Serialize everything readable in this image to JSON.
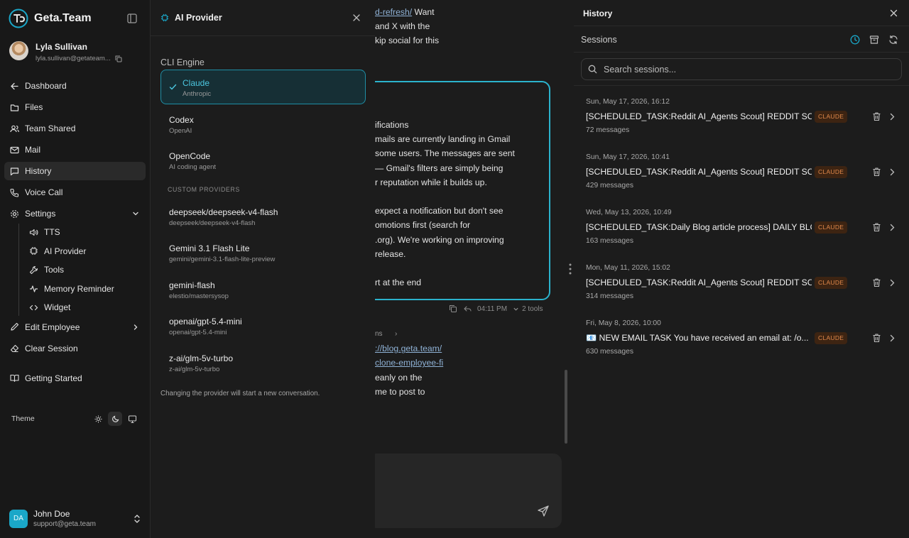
{
  "brand": {
    "name": "Geta.Team"
  },
  "user": {
    "name": "Lyla Sullivan",
    "email": "lyla.sullivan@getateam..."
  },
  "nav": {
    "dashboard": "Dashboard",
    "files": "Files",
    "team_shared": "Team Shared",
    "mail": "Mail",
    "history": "History",
    "voice_call": "Voice Call",
    "settings": "Settings",
    "settings_children": {
      "tts": "TTS",
      "ai_provider": "AI Provider",
      "tools": "Tools",
      "memory_reminder": "Memory Reminder",
      "widget": "Widget"
    },
    "edit_employee": "Edit Employee",
    "clear_session": "Clear Session",
    "getting_started": "Getting Started"
  },
  "theme": {
    "label": "Theme",
    "active": "dark"
  },
  "account": {
    "initials": "DA",
    "name": "John Doe",
    "email": "support@geta.team"
  },
  "provider_panel": {
    "title": "AI Provider",
    "section_label": "CLI Engine",
    "engines": [
      {
        "name": "Claude",
        "sub": "Anthropic",
        "selected": true
      },
      {
        "name": "Codex",
        "sub": "OpenAI",
        "selected": false
      },
      {
        "name": "OpenCode",
        "sub": "AI coding agent",
        "selected": false
      }
    ],
    "custom_label": "CUSTOM PROVIDERS",
    "custom": [
      {
        "name": "deepseek/deepseek-v4-flash",
        "sub": "deepseek/deepseek-v4-flash"
      },
      {
        "name": "Gemini 3.1 Flash Lite",
        "sub": "gemini/gemini-3.1-flash-lite-preview"
      },
      {
        "name": "gemini-flash",
        "sub": "elestio/mastersysop"
      },
      {
        "name": "openai/gpt-5.4-mini",
        "sub": "openai/gpt-5.4-mini"
      },
      {
        "name": "z-ai/glm-5v-turbo",
        "sub": "z-ai/glm-5v-turbo"
      }
    ],
    "note": "Changing the provider will start a new conversation."
  },
  "chat": {
    "top_lines": [
      {
        "link": "d-refresh/",
        "text": " Want"
      },
      {
        "link": "",
        "text": "and X with the"
      },
      {
        "link": "",
        "text": "kip social for this"
      }
    ],
    "bubble_lines": [
      "ifications",
      "mails are currently landing in Gmail",
      "some users. The messages are sent",
      "— Gmail's filters are simply being",
      "r reputation while it builds up.",
      "",
      " expect a notification but don't see",
      "omotions first (search for",
      ".org). We're working on improving",
      "release.",
      "",
      "rt at the end"
    ],
    "meta": {
      "time": "04:11 PM",
      "tools": "2 tools"
    },
    "second_lines": [
      {
        "link": "",
        "text": "ns"
      },
      {
        "link": "://blog.geta.team/",
        "text": ""
      },
      {
        "link": "clone-employee-fi",
        "text": ""
      },
      {
        "link": "",
        "text": "eanly on the"
      },
      {
        "link": "",
        "text": "me to post to"
      }
    ]
  },
  "history": {
    "title": "History",
    "sessions_label": "Sessions",
    "search_placeholder": "Search sessions...",
    "items": [
      {
        "date": "Sun, May 17, 2026, 16:12",
        "title": "[SCHEDULED_TASK:Reddit AI_Agents Scout] REDDIT SCOUT",
        "badge": "CLAUDE",
        "count": "72 messages"
      },
      {
        "date": "Sun, May 17, 2026, 10:41",
        "title": "[SCHEDULED_TASK:Reddit AI_Agents Scout] REDDIT SCOUT",
        "badge": "CLAUDE",
        "count": "429 messages"
      },
      {
        "date": "Wed, May 13, 2026, 10:49",
        "title": "[SCHEDULED_TASK:Daily Blog article process] DAILY BLOG",
        "badge": "CLAUDE",
        "count": "163 messages"
      },
      {
        "date": "Mon, May 11, 2026, 15:02",
        "title": "[SCHEDULED_TASK:Reddit AI_Agents Scout] REDDIT SCOUT",
        "badge": "CLAUDE",
        "count": "314 messages"
      },
      {
        "date": "Fri, May 8, 2026, 10:00",
        "title": "📧 NEW EMAIL TASK You have received an email at: /o...",
        "badge": "CLAUDE",
        "count": "630 messages"
      }
    ]
  },
  "colors": {
    "accent": "#1aa7c8",
    "badge_bg": "#3d2412",
    "badge_text": "#e0884a"
  }
}
